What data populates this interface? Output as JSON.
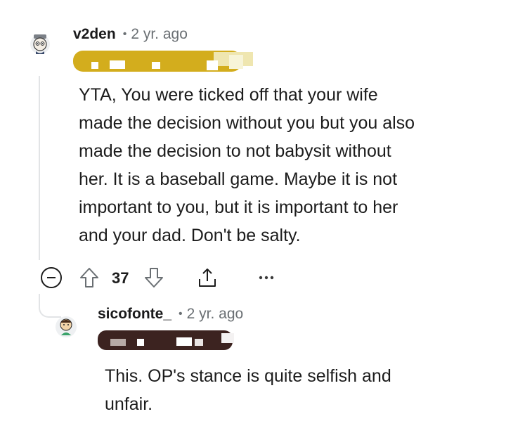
{
  "comment": {
    "username": "v2den",
    "separator": "•",
    "time": "2 yr. ago",
    "flair_color": "#d3ad1d",
    "body": [
      "YTA, You were ticked off that your wife",
      "made the decision without you but you also",
      "made the decision to not babysit without",
      "her. It is a baseball game. Maybe it is not",
      "important to you, but it is important to her",
      "and your dad. Don't be salty."
    ],
    "votes": "37",
    "icons": [
      "collapse-icon",
      "upvote-icon",
      "downvote-icon",
      "share-icon",
      "more-icon"
    ]
  },
  "reply": {
    "username": "sicofonte_",
    "separator": "•",
    "time": "2 yr. ago",
    "flair_color": "#3c2320",
    "body": [
      "This. OP's stance is quite selfish and",
      "unfair."
    ]
  }
}
